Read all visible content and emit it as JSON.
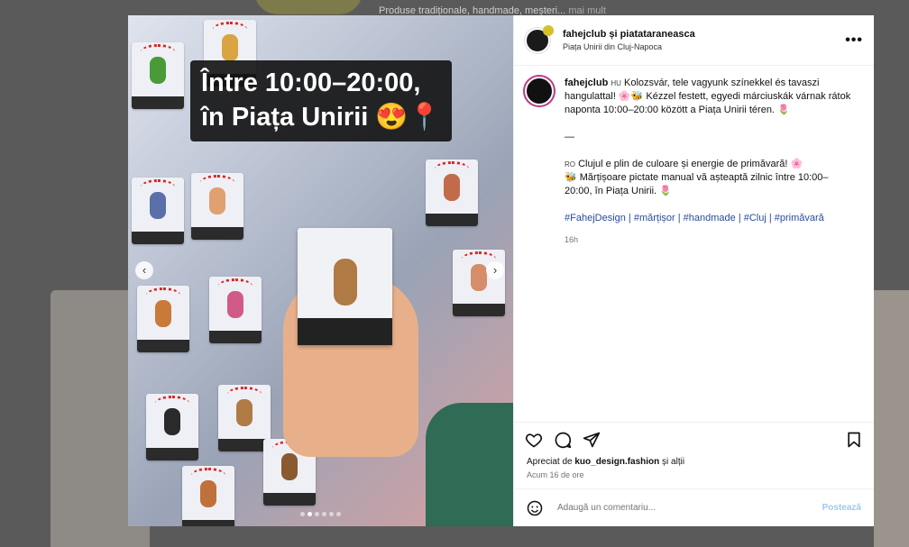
{
  "background": {
    "line1": "Produse tradiționale, handmade, meșteri... ",
    "more": "mai mult"
  },
  "media": {
    "overlay_line1": "Între 10:00–20:00,",
    "overlay_line2": "în Piața Unirii 😍📍",
    "prev_icon": "chevron-left",
    "next_icon": "chevron-right",
    "slide_count": 6,
    "active_slide": 2
  },
  "header": {
    "username": "fahejclub și piatataraneasca",
    "location": "Piața Unirii din Cluj-Napoca",
    "more_icon": "•••"
  },
  "caption": {
    "username": "fahejclub",
    "hu_tag": "HU",
    "hu_text": "Kolozsvár, tele vagyunk színekkel és tavaszi hangulattal! 🌸🐝 Kézzel festett, egyedi márciuskák várnak rátok naponta 10:00–20:00 között a Piața Unirii téren. 🌷",
    "divider": "—",
    "ro_tag": "RO",
    "ro_text1": "Clujul e plin de culoare și energie de primăvară! 🌸",
    "ro_text2": "🐝 Mărțișoare pictate manual vă așteaptă zilnic între 10:00–20:00, în Piața Unirii. 🌷",
    "hashtags": "#FahejDesign | #mărțișor | #handmade | #Cluj | #primăvară",
    "time": "16h"
  },
  "likes": {
    "prefix": "Apreciat de ",
    "user": "kuo_design.fashion",
    "suffix": " și alții",
    "ago": "Acum 16 de ore"
  },
  "comment_box": {
    "placeholder": "Adaugă un comentariu...",
    "post_label": "Postează"
  }
}
